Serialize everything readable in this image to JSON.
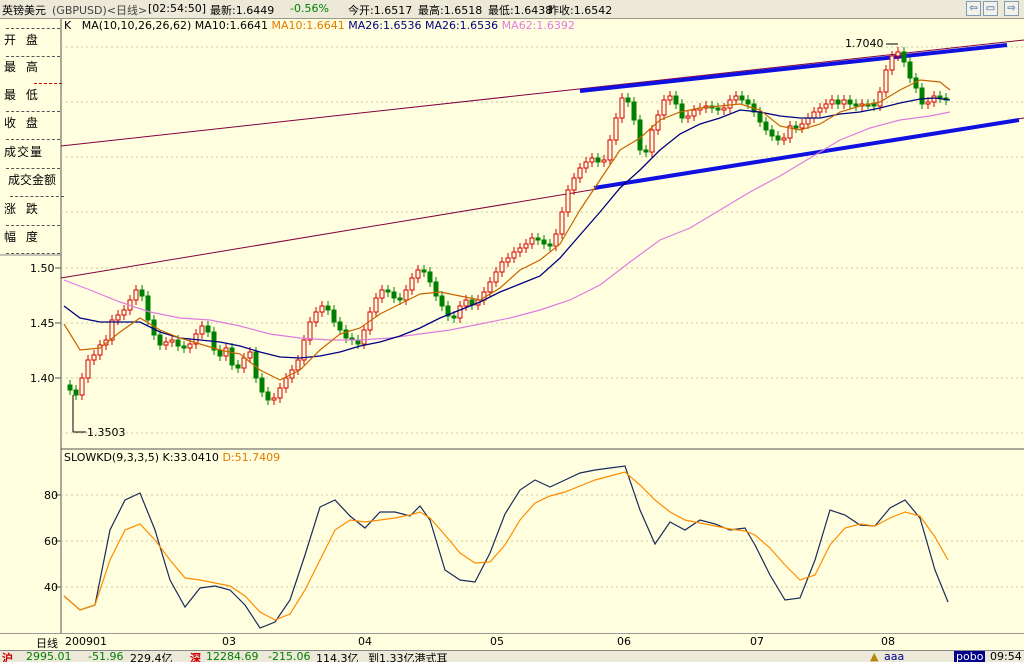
{
  "title": {
    "instrument": "英镑美元",
    "code": "(GBPUSD)<日线>",
    "time": "[02:54:50]",
    "latest": "最新:1.6449",
    "change": "-0.56%",
    "open": "今开:1.6517",
    "high": "最高:1.6518",
    "low": "最低:1.6438",
    "prev_close": "昨收:1.6542"
  },
  "colors": {
    "background": "#ffffe0",
    "up": "#d40000",
    "down": "#008000",
    "ma10": "#e07b00",
    "ma26": "#000080",
    "ma62": "#e07be0",
    "trend": "#1010e0",
    "channel": "#800040",
    "k_line": "#1a2a5a",
    "d_line": "#ff8c00"
  },
  "left_panel": {
    "items": [
      "开 盘",
      "最 高",
      "最 低",
      "收 盘",
      "成交量",
      "成交金额",
      "涨 跌",
      "幅 度"
    ]
  },
  "ma_line": {
    "k": "K",
    "label": "MA(10,10,26,26,62)",
    "ma10a": "MA10:1.6641",
    "ma10b": "MA10:1.6641",
    "ma26a": "MA26:1.6536",
    "ma26b": "MA26:1.6536",
    "ma62": "MA62:1.6392"
  },
  "kd_line": {
    "label": "SLOWKD(9,3,3,5)",
    "k": "K:33.0410",
    "d": "D:51.7409"
  },
  "price_axis": [
    "1.50",
    "1.45",
    "1.40"
  ],
  "kd_axis": [
    "80",
    "60",
    "40"
  ],
  "annotations": {
    "high": "1.7040",
    "low": "1.3503"
  },
  "date_axis": {
    "period": "日线",
    "labels": [
      "200901",
      "03",
      "04",
      "05",
      "06",
      "07",
      "08"
    ]
  },
  "status": {
    "sh": "沪",
    "sh_index": "2995.01",
    "sh_change": "-51.96",
    "sh_amount": "229.4亿",
    "sz": "深",
    "sz_index": "12284.69",
    "sz_change": "-215.06",
    "sz_amount": "114.3亿",
    "news": "到1.33亿港式耳",
    "tag": "aaa",
    "brand": "pobo",
    "clock": "09:54"
  }
}
